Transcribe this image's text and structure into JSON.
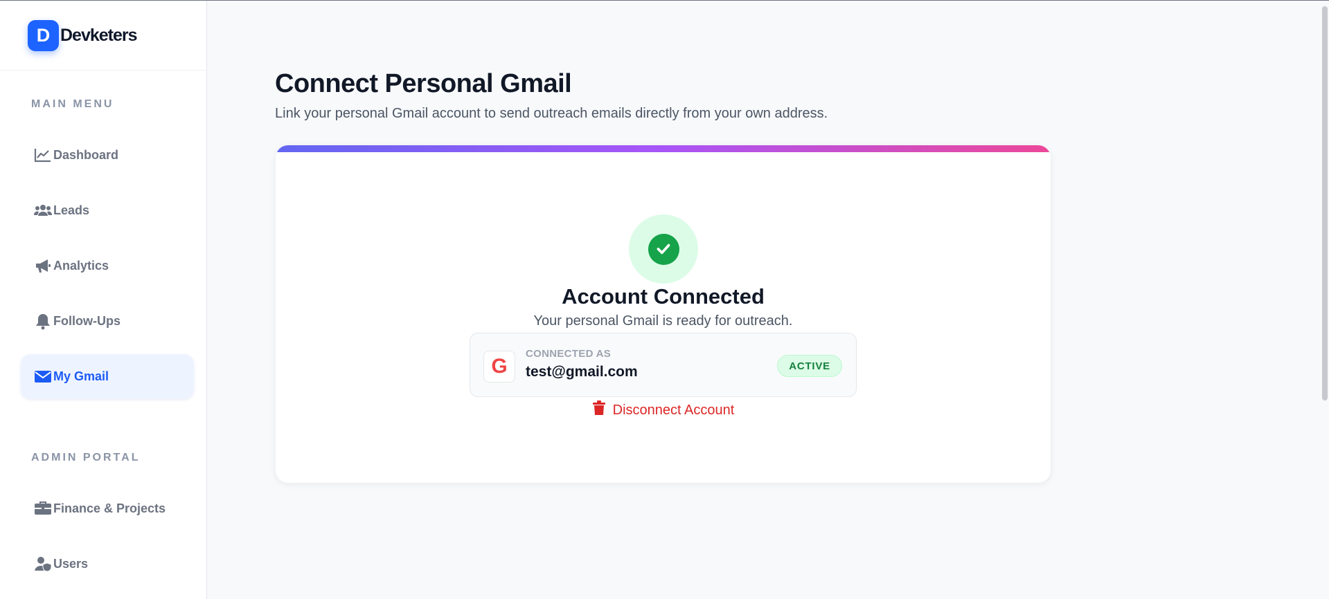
{
  "brand": {
    "logo_letter": "D",
    "name": "Devketers"
  },
  "sidebar": {
    "main_menu_label": "MAIN MENU",
    "main_items": [
      {
        "label": "Dashboard",
        "icon": "chart-line-icon"
      },
      {
        "label": "Leads",
        "icon": "users-icon"
      },
      {
        "label": "Analytics",
        "icon": "megaphone-icon"
      },
      {
        "label": "Follow-Ups",
        "icon": "bell-icon"
      },
      {
        "label": "My Gmail",
        "icon": "envelope-icon",
        "active": true
      }
    ],
    "admin_label": "ADMIN PORTAL",
    "admin_items": [
      {
        "label": "Finance & Projects",
        "icon": "briefcase-icon"
      },
      {
        "label": "Users",
        "icon": "user-shield-icon"
      }
    ]
  },
  "main": {
    "title": "Connect Personal Gmail",
    "description": "Link your personal Gmail account to send outreach emails directly from your own address."
  },
  "card": {
    "heading": "Account Connected",
    "subtitle": "Your personal Gmail is ready for outreach.",
    "account": {
      "provider_letter": "G",
      "connected_label": "CONNECTED AS",
      "email": "test@gmail.com",
      "status": "ACTIVE"
    },
    "disconnect_label": "Disconnect Account"
  },
  "colors": {
    "accent": "#1d63ff",
    "success": "#16a34a",
    "danger": "#dc2626",
    "gradient_start": "#6366f1",
    "gradient_mid": "#a855f7",
    "gradient_end": "#ec4899"
  }
}
